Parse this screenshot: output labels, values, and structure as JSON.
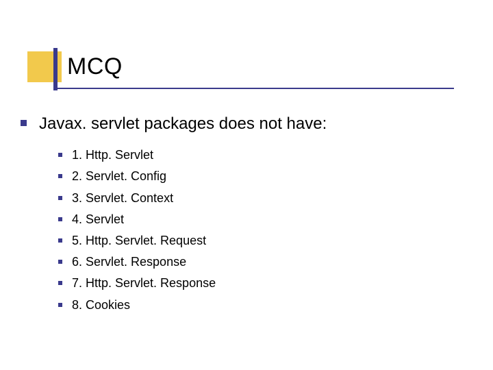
{
  "slide": {
    "title": "MCQ",
    "question": "Javax. servlet packages does not have:",
    "options": [
      "1. Http. Servlet",
      "2. Servlet. Config",
      "3. Servlet. Context",
      "4. Servlet",
      "5. Http. Servlet. Request",
      "6. Servlet. Response",
      "7. Http. Servlet. Response",
      "8. Cookies"
    ]
  }
}
